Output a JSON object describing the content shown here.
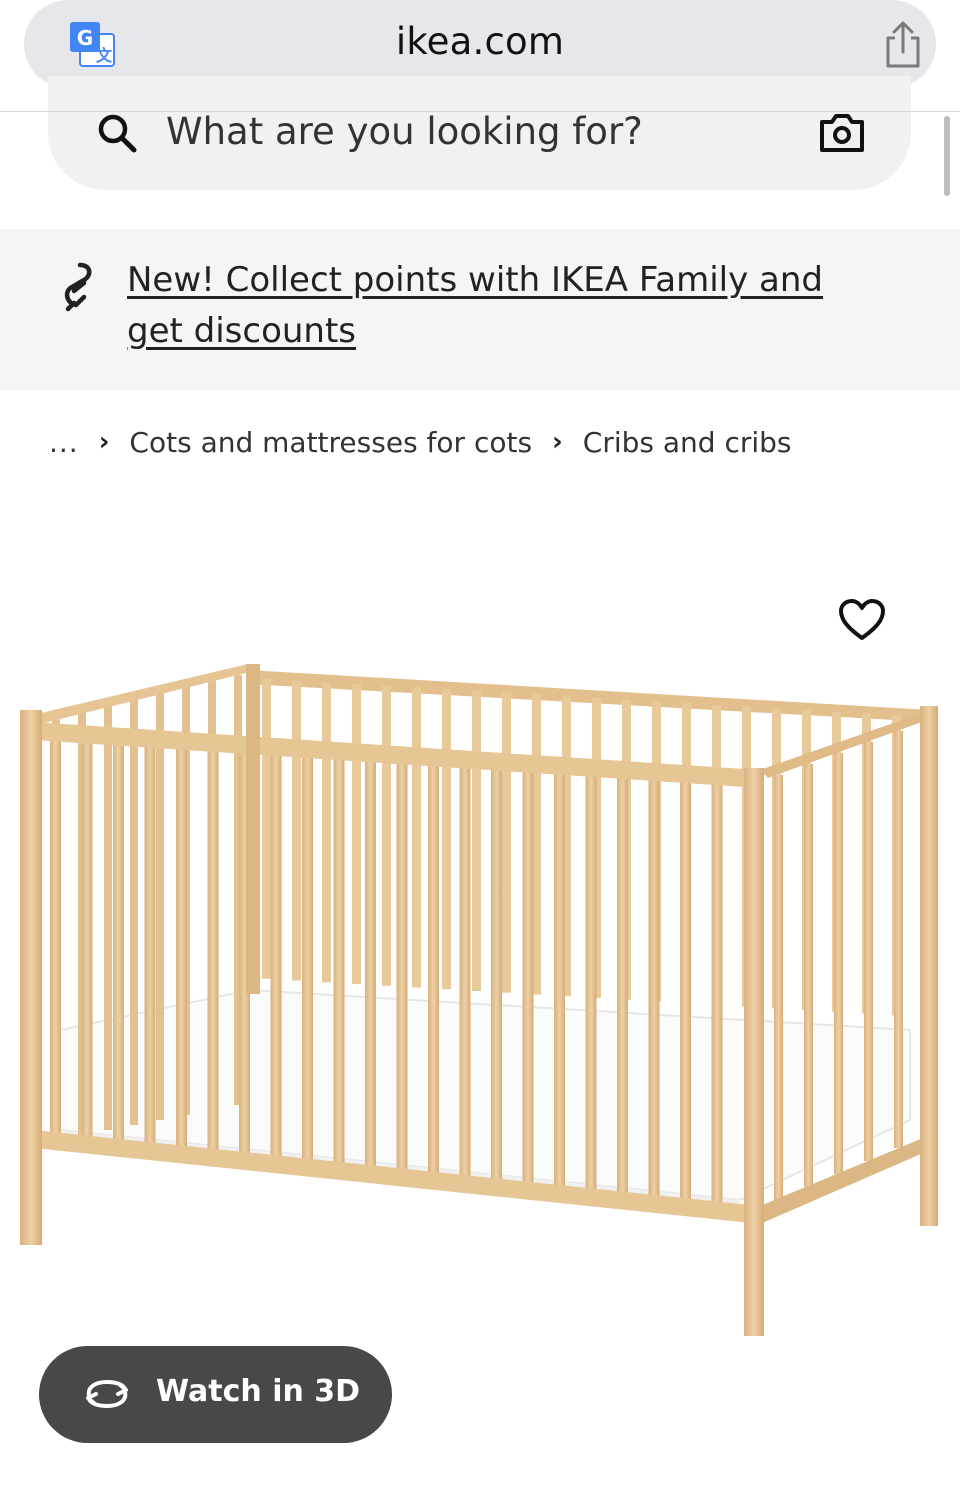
{
  "browser": {
    "domain": "ikea.com",
    "translate_icon": "translate-icon",
    "share_icon": "share-icon"
  },
  "search": {
    "placeholder": "What are you looking for?",
    "search_icon": "magnifier-icon",
    "camera_icon": "camera-icon"
  },
  "banner": {
    "text": "New! Collect points with IKEA Family and get discounts",
    "icon": "ikea-family-icon"
  },
  "breadcrumb": {
    "ellipsis": "...",
    "items": [
      "Cots and mattresses for cots",
      "Cribs and cribs"
    ]
  },
  "product": {
    "favorite_icon": "heart-icon",
    "watch_3d_label": "Watch in 3D",
    "watch_3d_icon": "rotate-3d-icon"
  },
  "colors": {
    "wood": "#e6c394",
    "wood_dark": "#c9a06c",
    "mattress": "#ffffff",
    "button_bg": "#484848"
  }
}
